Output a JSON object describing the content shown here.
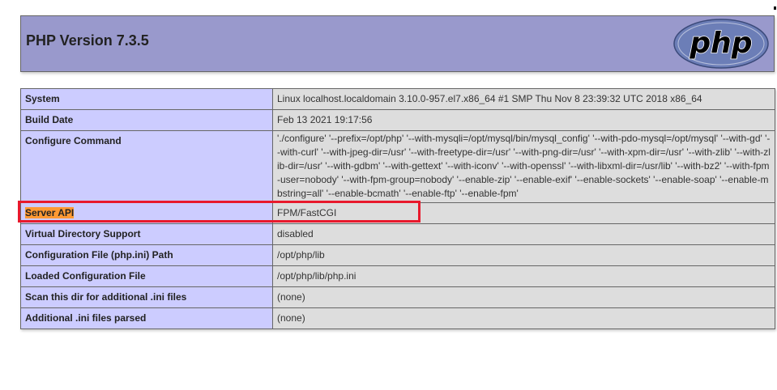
{
  "page": {
    "title": "PHP Version 7.3.5",
    "logo_text": "php",
    "logo_color": "#6c7eb7",
    "header_bg": "#9999cc",
    "key_bg": "#ccccff",
    "value_bg": "#dddddd",
    "highlight_color": "#ff9933",
    "annotation_color": "#e8192c"
  },
  "rows": [
    {
      "key": "System",
      "value": "Linux localhost.localdomain 3.10.0-957.el7.x86_64 #1 SMP Thu Nov 8 23:39:32 UTC 2018 x86_64"
    },
    {
      "key": "Build Date",
      "value": "Feb 13 2021 19:17:56"
    },
    {
      "key": "Configure Command",
      "value": "'./configure' '--prefix=/opt/php' '--with-mysqli=/opt/mysql/bin/mysql_config' '--with-pdo-mysql=/opt/mysql' '--with-gd' '--with-curl' '--with-jpeg-dir=/usr' '--with-freetype-dir=/usr' '--with-png-dir=/usr' '--with-xpm-dir=/usr' '--with-zlib' '--with-zlib-dir=/usr' '--with-gdbm' '--with-gettext' '--with-iconv' '--with-openssl' '--with-libxml-dir=/usr/lib' '--with-bz2' '--with-fpm-user=nobody' '--with-fpm-group=nobody' '--enable-zip' '--enable-exif' '--enable-sockets' '--enable-soap' '--enable-mbstring=all' '--enable-bcmath' '--enable-ftp' '--enable-fpm'"
    },
    {
      "key": "Server API",
      "value": "FPM/FastCGI"
    },
    {
      "key": "Virtual Directory Support",
      "value": "disabled"
    },
    {
      "key": "Configuration File (php.ini) Path",
      "value": "/opt/php/lib"
    },
    {
      "key": "Loaded Configuration File",
      "value": "/opt/php/lib/php.ini"
    },
    {
      "key": "Scan this dir for additional .ini files",
      "value": "(none)"
    },
    {
      "key": "Additional .ini files parsed",
      "value": "(none)"
    }
  ]
}
